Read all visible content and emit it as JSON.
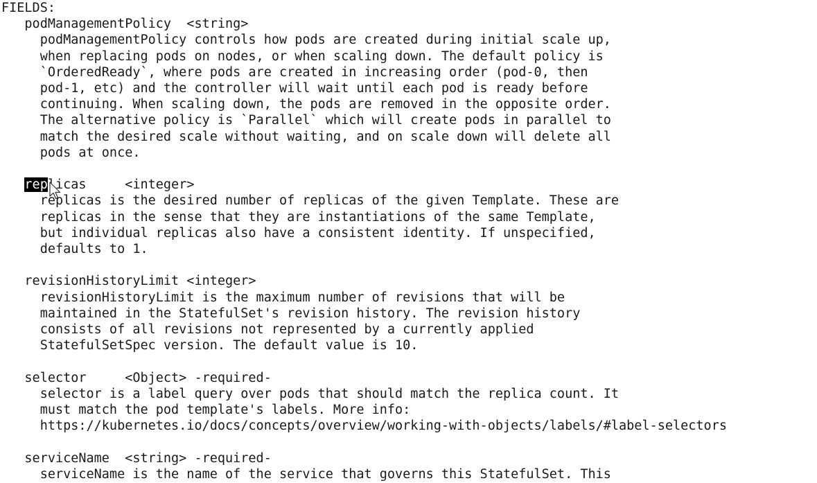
{
  "terminal": {
    "lines": [
      "FIELDS:",
      "   podManagementPolicy  <string>",
      "     podManagementPolicy controls how pods are created during initial scale up,",
      "     when replacing pods on nodes, or when scaling down. The default policy is",
      "     `OrderedReady`, where pods are created in increasing order (pod-0, then",
      "     pod-1, etc) and the controller will wait until each pod is ready before",
      "     continuing. When scaling down, the pods are removed in the opposite order.",
      "     The alternative policy is `Parallel` which will create pods in parallel to",
      "     match the desired scale without waiting, and on scale down will delete all",
      "     pods at once.",
      "",
      "",
      "     replicas is the desired number of replicas of the given Template. These are",
      "     replicas in the sense that they are instantiations of the same Template,",
      "     but individual replicas also have a consistent identity. If unspecified,",
      "     defaults to 1.",
      "",
      "   revisionHistoryLimit <integer>",
      "     revisionHistoryLimit is the maximum number of revisions that will be",
      "     maintained in the StatefulSet's revision history. The revision history",
      "     consists of all revisions not represented by a currently applied",
      "     StatefulSetSpec version. The default value is 10.",
      "",
      "   selector     <Object> -required-",
      "     selector is a label query over pods that should match the replica count. It",
      "     must match the pod template's labels. More info:",
      "     https://kubernetes.io/docs/concepts/overview/working-with-objects/labels/#label-selectors",
      "",
      "   serviceName  <string> -required-",
      "     serviceName is the name of the service that governs this StatefulSet. This"
    ],
    "replicas_line": {
      "indent": "   ",
      "selected": "rep",
      "rest": "licas     <integer>"
    }
  }
}
